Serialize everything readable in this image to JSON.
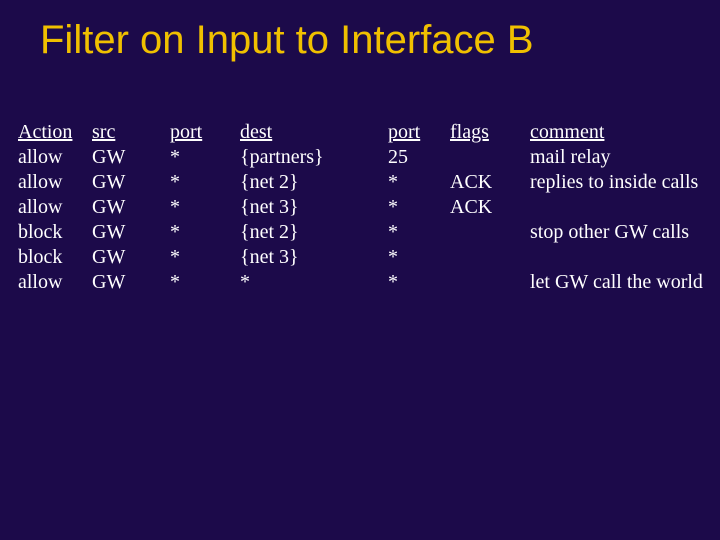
{
  "title": "Filter on Input to Interface B",
  "headers": {
    "action": "Action",
    "src": "src",
    "port1": "port",
    "dest": "dest",
    "port2": "port",
    "flags": "flags",
    "comment": "comment"
  },
  "rows": [
    {
      "action": "allow",
      "src": "GW",
      "port1": "*",
      "dest": "{partners}",
      "port2": "25",
      "flags": "",
      "comment": "mail relay"
    },
    {
      "action": "allow",
      "src": "GW",
      "port1": "*",
      "dest": "{net 2}",
      "port2": "*",
      "flags": "ACK",
      "comment": "replies to inside calls"
    },
    {
      "action": "allow",
      "src": "GW",
      "port1": "*",
      "dest": "{net 3}",
      "port2": "*",
      "flags": "ACK",
      "comment": ""
    },
    {
      "action": "block",
      "src": "GW",
      "port1": "*",
      "dest": "{net 2}",
      "port2": "*",
      "flags": "",
      "comment": "stop other GW calls"
    },
    {
      "action": "block",
      "src": "GW",
      "port1": "*",
      "dest": "{net 3}",
      "port2": "*",
      "flags": "",
      "comment": ""
    },
    {
      "action": "allow",
      "src": "GW",
      "port1": "*",
      "dest": "*",
      "port2": "*",
      "flags": "",
      "comment": "let GW call the world"
    }
  ]
}
